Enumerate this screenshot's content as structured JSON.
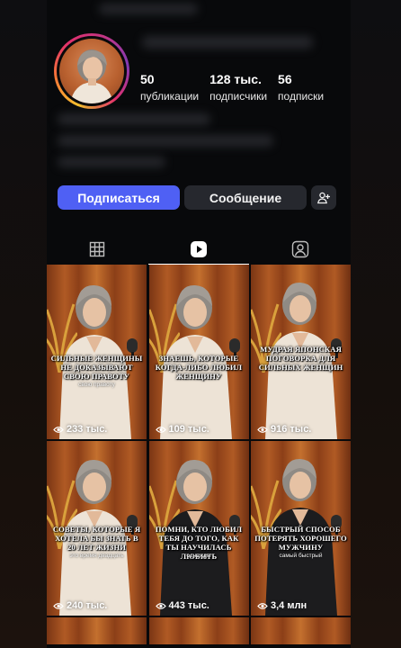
{
  "profile": {
    "stats": [
      {
        "value": "50",
        "label": "публикации"
      },
      {
        "value": "128 тыс.",
        "label": "подписчики"
      },
      {
        "value": "56",
        "label": "подписки"
      }
    ]
  },
  "actions": {
    "follow_label": "Подписаться",
    "message_label": "Сообщение",
    "add_icon": "person-add-icon"
  },
  "tabs": [
    {
      "icon": "grid-icon",
      "active": false
    },
    {
      "icon": "reels-play-icon",
      "active": true
    },
    {
      "icon": "tagged-person-icon",
      "active": false
    }
  ],
  "reels": [
    {
      "caption": "СИЛЬНЫЕ ЖЕНЩИНЫ НЕ ДОКАЗЫВАЮТ СВОЮ ПРАВОТУ",
      "sub": "свою правоту",
      "views": "233 тыс."
    },
    {
      "caption": "ЗНАЕШЬ, КОТОРЫЕ КОГДА-ЛИБО ЛЮБИЛ ЖЕНЩИНУ",
      "sub": "",
      "views": "109 тыс."
    },
    {
      "caption": "МУДРАЯ ЯПОНСКАЯ ПОГОВОРКА ДЛЯ СИЛЬНЫХ ЖЕНЩИН",
      "sub": "",
      "views": "916 тыс."
    },
    {
      "caption": "СОВЕТЫ, КОТОРЫЕ Я ХОТЕЛА БЫ ЗНАТЬ В 20 ЛЕТ ЖИЗНИ",
      "sub": "это время двадцать",
      "views": "240 тыс."
    },
    {
      "caption": "ПОМНИ, КТО ЛЮБИЛ ТЕБЯ ДО ТОГО, КАК ТЫ НАУЧИЛАСЬ ЛЮБИТЬ",
      "sub": "однажды",
      "views": "443 тыс."
    },
    {
      "caption": "БЫСТРЫЙ СПОСОБ ПОТЕРЯТЬ ХОРОШЕГО МУЖЧИНУ",
      "sub": "самый быстрый",
      "views": "3,4 млн"
    }
  ],
  "colors": {
    "accent": "#4f60f4",
    "background": "#08090b",
    "secondary_button": "#26282e"
  }
}
